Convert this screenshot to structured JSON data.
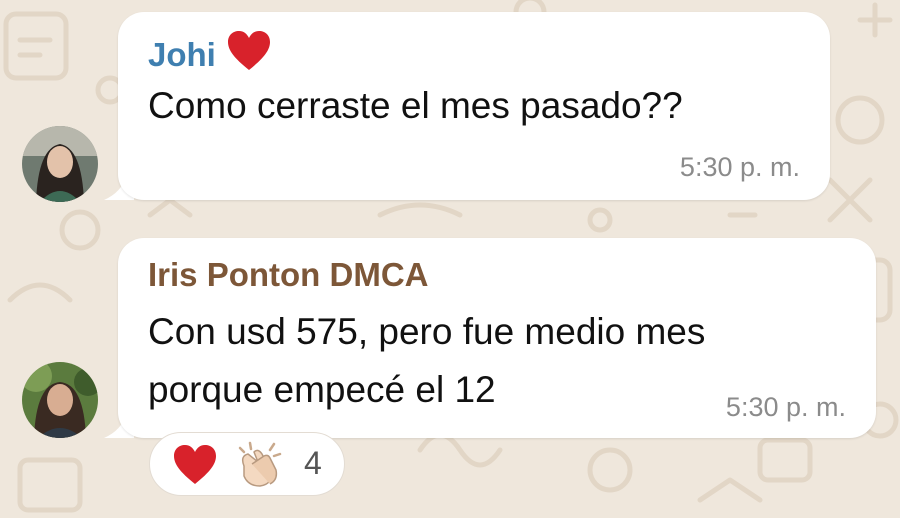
{
  "colors": {
    "wallpaper": "#efe7dc",
    "bubble": "#ffffff",
    "sender_1": "#3f7fb0",
    "sender_2": "#7d5738",
    "timestamp": "#8b8b8b",
    "heart": "#d8222b"
  },
  "messages": [
    {
      "sender": "Johi",
      "sender_emoji": "heart",
      "text_lines": [
        "Como cerraste el mes pasado??"
      ],
      "time": "5:30 p. m."
    },
    {
      "sender": "Iris Ponton DMCA",
      "text_lines": [
        "Con usd 575, pero fue medio mes",
        "porque empecé el 12"
      ],
      "time": "5:30 p. m.",
      "reactions": {
        "emojis": [
          "heart",
          "clapping-hands"
        ],
        "count": "4"
      }
    }
  ]
}
